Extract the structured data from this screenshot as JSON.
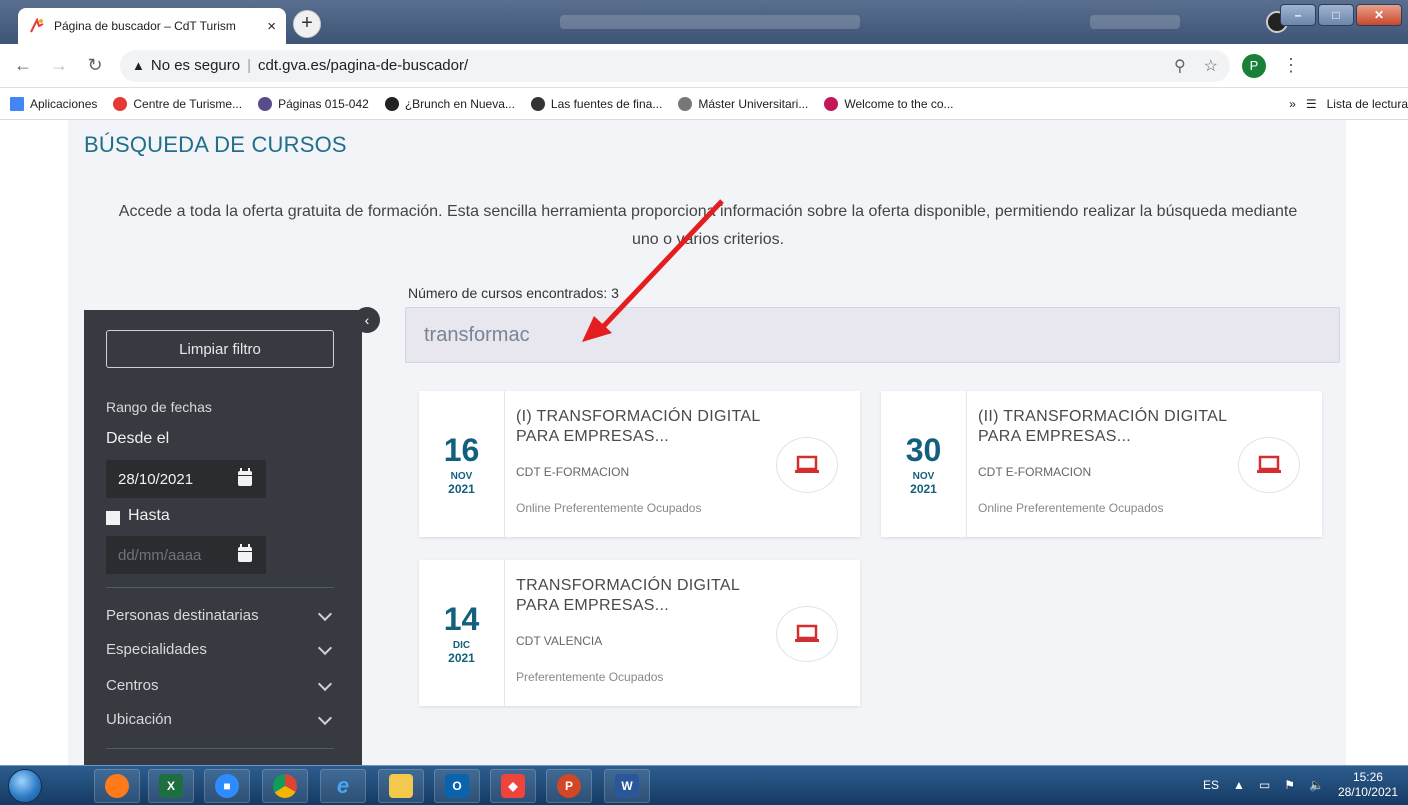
{
  "browser": {
    "tab_title": "Página de buscador – CdT Turism",
    "tab_close": "×",
    "new_tab": "+",
    "address": {
      "security_text": "No es seguro",
      "separator": "|",
      "url": "cdt.gva.es/pagina-de-buscador/"
    },
    "profile_initial": "P",
    "bookmarks": [
      {
        "label": "Aplicaciones",
        "icon": "apps-grid-icon",
        "color": "#4285f4"
      },
      {
        "label": "Centre de Turisme...",
        "icon": "centre-turisme-icon",
        "color": "#e53935"
      },
      {
        "label": "Páginas 015-042",
        "icon": "seal-icon",
        "color": "#5c4b8a"
      },
      {
        "label": "¿Brunch en Nueva...",
        "icon": "e-logo-icon",
        "color": "#222222"
      },
      {
        "label": "Las fuentes de fina...",
        "icon": "list-doc-icon",
        "color": "#333333"
      },
      {
        "label": "Máster Universitari...",
        "icon": "uni-icon",
        "color": "#777777"
      },
      {
        "label": "Welcome to the co...",
        "icon": "welcome-icon",
        "color": "#c2185b"
      }
    ],
    "bookmarks_more": "»",
    "reading_list": "Lista de lectura"
  },
  "page": {
    "title": "BÚSQUEDA DE CURSOS",
    "intro": "Accede a toda la oferta gratuita de formación. Esta sencilla herramienta proporciona información sobre la oferta disponible, permitiendo realizar la búsqueda mediante uno o varios criterios.",
    "result_count_label": "Número de cursos encontrados: 3",
    "search_value": "transformac"
  },
  "sidebar": {
    "clear_filter": "Limpiar filtro",
    "date_range_label": "Rango de fechas",
    "from_label": "Desde el",
    "from_value": "28/10/2021",
    "until_label": "Hasta",
    "until_placeholder": "dd/mm/aaaa",
    "filters": [
      "Personas destinatarias",
      "Especialidades",
      "Centros",
      "Ubicación"
    ]
  },
  "courses": [
    {
      "day": "16",
      "month": "NOV",
      "year": "2021",
      "title": "(I) TRANSFORMACIÓN DIGITAL PARA EMPRESAS...",
      "center": "CDT E-FORMACION",
      "modality": "Online Preferentemente Ocupados"
    },
    {
      "day": "30",
      "month": "NOV",
      "year": "2021",
      "title": "(II) TRANSFORMACIÓN DIGITAL PARA EMPRESAS...",
      "center": "CDT E-FORMACION",
      "modality": "Online Preferentemente Ocupados"
    },
    {
      "day": "14",
      "month": "DIC",
      "year": "2021",
      "title": "TRANSFORMACIÓN DIGITAL PARA EMPRESAS...",
      "center": "CDT VALENCIA",
      "modality": "Preferentemente Ocupados"
    }
  ],
  "taskbar": {
    "apps": [
      "firefox-icon",
      "excel-icon",
      "zoom-icon",
      "chrome-icon",
      "ie-icon",
      "explorer-icon",
      "outlook-icon",
      "anydesk-icon",
      "powerpoint-icon",
      "word-icon"
    ],
    "language": "ES",
    "time": "15:26",
    "date": "28/10/2021"
  },
  "colors": {
    "accent": "#1f6f8b",
    "date_blue": "#13607d",
    "laptop_red": "#d32f2f",
    "sidebar_bg": "#373a40",
    "annotation_red": "#e41e1e"
  }
}
